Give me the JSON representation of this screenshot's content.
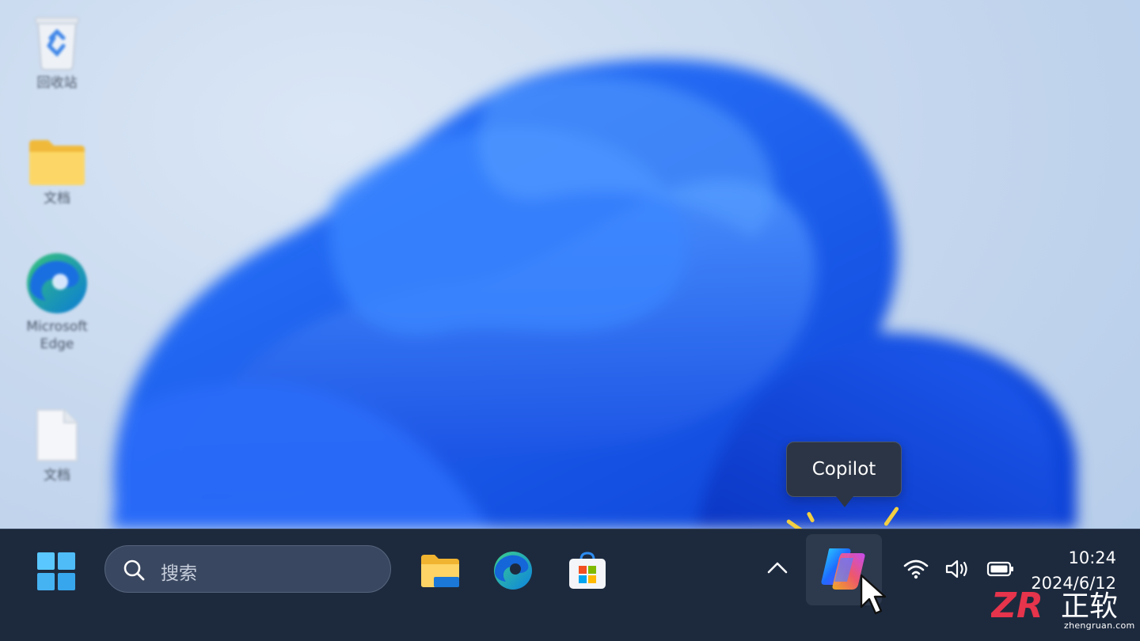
{
  "desktop": {
    "icons": [
      {
        "label": "回收站",
        "icon": "recycle-bin-icon"
      },
      {
        "label": "文档",
        "icon": "folder-icon"
      },
      {
        "label": "Microsoft Edge",
        "icon": "edge-icon"
      },
      {
        "label": "文档",
        "icon": "document-file-icon"
      }
    ]
  },
  "tooltip": {
    "text": "Copilot"
  },
  "taskbar": {
    "search_placeholder": "搜索",
    "apps": [
      {
        "name": "File Explorer",
        "icon": "folder-icon"
      },
      {
        "name": "Microsoft Edge",
        "icon": "edge-icon"
      },
      {
        "name": "Microsoft Store",
        "icon": "store-icon"
      }
    ],
    "copilot_icon": "copilot-icon",
    "tray_icons": [
      "chevron-up-icon",
      "wifi-icon",
      "volume-icon",
      "battery-icon"
    ],
    "clock": {
      "time": "10:24",
      "date": "2024/6/12"
    }
  },
  "watermark": {
    "brand": "正软",
    "site": "zhengruan.com"
  },
  "colors": {
    "taskbar_bg": "#1d2a3e",
    "accent_blue": "#1a5df0",
    "tooltip_bg": "#2c3545",
    "highlight_yellow": "#f2cf42",
    "watermark_red": "#e5344b"
  }
}
